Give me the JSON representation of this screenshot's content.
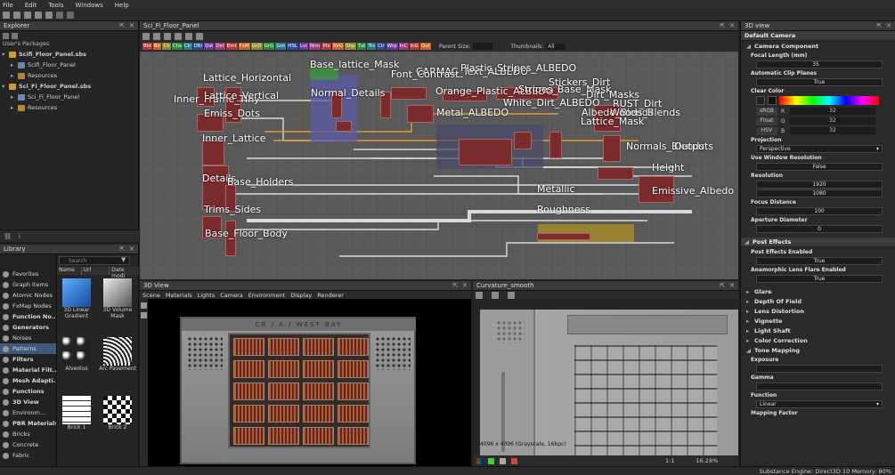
{
  "menu": [
    "File",
    "Edit",
    "Tools",
    "Windows",
    "Help"
  ],
  "explorer": {
    "title": "Explorer",
    "section": "User's Packages",
    "items": [
      {
        "label": "Scifi_Floor_Panel.sbs",
        "level": 0,
        "bold": true
      },
      {
        "label": "Scifi_Floor_Panel",
        "level": 1,
        "bold": false
      },
      {
        "label": "Resources",
        "level": 1,
        "bold": false
      },
      {
        "label": "Sci_Fi_Floor_Panel.sbs",
        "level": 0,
        "bold": true
      },
      {
        "label": "Sci_Fi_Floor_Panel",
        "level": 1,
        "bold": false
      },
      {
        "label": "Resources",
        "level": 1,
        "bold": false
      }
    ]
  },
  "library": {
    "title": "Library",
    "search_placeholder": "Search",
    "col_name": "Name",
    "col_url": "Url",
    "col_date": "Date modi",
    "categories": [
      {
        "label": "Favorites",
        "bold": false
      },
      {
        "label": "Graph Items",
        "bold": false
      },
      {
        "label": "Atomic Nodes",
        "bold": false
      },
      {
        "label": "FxMap Nodes",
        "bold": false
      },
      {
        "label": "Function No...",
        "bold": true
      },
      {
        "label": "Generators",
        "bold": true
      },
      {
        "label": "Noises",
        "bold": false
      },
      {
        "label": "Patterns",
        "bold": false
      },
      {
        "label": "Filters",
        "bold": true
      },
      {
        "label": "Material Filt...",
        "bold": true
      },
      {
        "label": "Mesh Adapti...",
        "bold": true
      },
      {
        "label": "Functions",
        "bold": true
      },
      {
        "label": "3D View",
        "bold": true
      },
      {
        "label": "Environm...",
        "bold": false
      },
      {
        "label": "PBR Materials",
        "bold": true
      },
      {
        "label": "Bricks",
        "bold": false
      },
      {
        "label": "Concrete",
        "bold": false
      },
      {
        "label": "Fabric",
        "bold": false
      }
    ],
    "thumbs": [
      {
        "label": "3D Linear Gradient"
      },
      {
        "label": "3D Volume Mask"
      },
      {
        "label": "Alveolus"
      },
      {
        "label": "Arc Pavement"
      },
      {
        "label": "Brick 1"
      },
      {
        "label": "Brick 2"
      }
    ]
  },
  "graph": {
    "tab": "Sci_Fi_Floor_Panel",
    "chips": [
      "Bld",
      "Blr",
      "Ch",
      "Chs",
      "Clr",
      "DBl",
      "Dst",
      "Dst",
      "Emt",
      "FxM",
      "GrD",
      "GrG",
      "Grn",
      "HSL",
      "Lvl",
      "Nrm",
      "Plx",
      "SVG",
      "Shp",
      "Txt",
      "Trs",
      "Clr",
      "Wrp",
      "InC",
      "InG",
      "Out"
    ],
    "parent_size_label": "Parent Size:",
    "thumbnails_label": "Thumbnails:",
    "thumbnails_value": "All",
    "labels": [
      "Base_lattice_Mask",
      "Lattice_Horizontal",
      "CARMAC_Text_ALBEDO",
      "Plastic_Stripes_ALBEDO",
      "Font_Contrast",
      "Inner_Frame_Tiny",
      "Lattice_Vertical",
      "Normal_Details",
      "Orange_Plastic_ALBEDO",
      "Stripes_Base_Mask",
      "Stickers_Dirt",
      "Dirt_Masks",
      "White_Dirt_ALBEDO",
      "RUST_Dirt",
      "Emiss_Dots",
      "Metal_ALBEDO",
      "Albedo_Blends",
      "Woods_Blends",
      "Lattice_Mask",
      "Inner_Lattice",
      "Normals_Blends",
      "Outputs",
      "Details",
      "Height",
      "Base_Holders",
      "Emissive_Albedo",
      "Metallic",
      "Trims_Sides",
      "Roughness",
      "Base_Floor_Body"
    ]
  },
  "view3d": {
    "title": "3D View",
    "menu": [
      "Scene",
      "Materials",
      "Lights",
      "Camera",
      "Environment",
      "Display",
      "Renderer"
    ],
    "stencil": "CR / A / WEST BAY"
  },
  "view2d": {
    "title": "Curvature_smooth",
    "info": "4096 x 4096 (Grayscale, 16bpc)",
    "page": "1:1",
    "zoom": "16.28%"
  },
  "props": {
    "title": "3D view",
    "section": "Default Camera",
    "camera_component": "Camera Component",
    "focal_label": "Focal Length (mm)",
    "focal_value": "35",
    "autoclip_label": "Automatic Clip Planes",
    "autoclip_value": "True",
    "clear_label": "Clear Color",
    "srgb": "sRGB",
    "float": "Float",
    "hsv": "HSV",
    "r_label": "R",
    "g_label": "G",
    "b_label": "B",
    "r": "32",
    "g": "32",
    "b": "32",
    "projection_label": "Projection",
    "projection_value": "Perspective",
    "usewin_label": "Use Window Resolution",
    "usewin_value": "False",
    "res_label": "Resolution",
    "res_w": "1920",
    "res_h": "1080",
    "focus_label": "Focus Distance",
    "focus_value": "100",
    "aperture_label": "Aperture Diameter",
    "aperture_value": "0",
    "post_effects": "Post Effects",
    "pe_enabled_label": "Post Effects Enabled",
    "pe_enabled_value": "True",
    "anam_label": "Anamorphic Lens Flare Enabled",
    "anam_value": "True",
    "collapsed": [
      "Glare",
      "Depth Of Field",
      "Lens Distortion",
      "Vignette",
      "Light Shaft",
      "Color Correction"
    ],
    "tone_mapping": "Tone Mapping",
    "exposure_label": "Exposure",
    "gamma_label": "Gamma",
    "function_label": "Function",
    "function_value": "Linear",
    "mapping_label": "Mapping Factor"
  },
  "status": "Substance Engine: Direct3D 10  Memory: 80%",
  "colors": {
    "accent": "#3d7ab8",
    "node": "#7a2b2b",
    "wire": "#d9d9d9",
    "orange_wire": "#e69a2e",
    "frame_purple": "#5a5aa8",
    "frame_yellow": "#b0902a"
  }
}
